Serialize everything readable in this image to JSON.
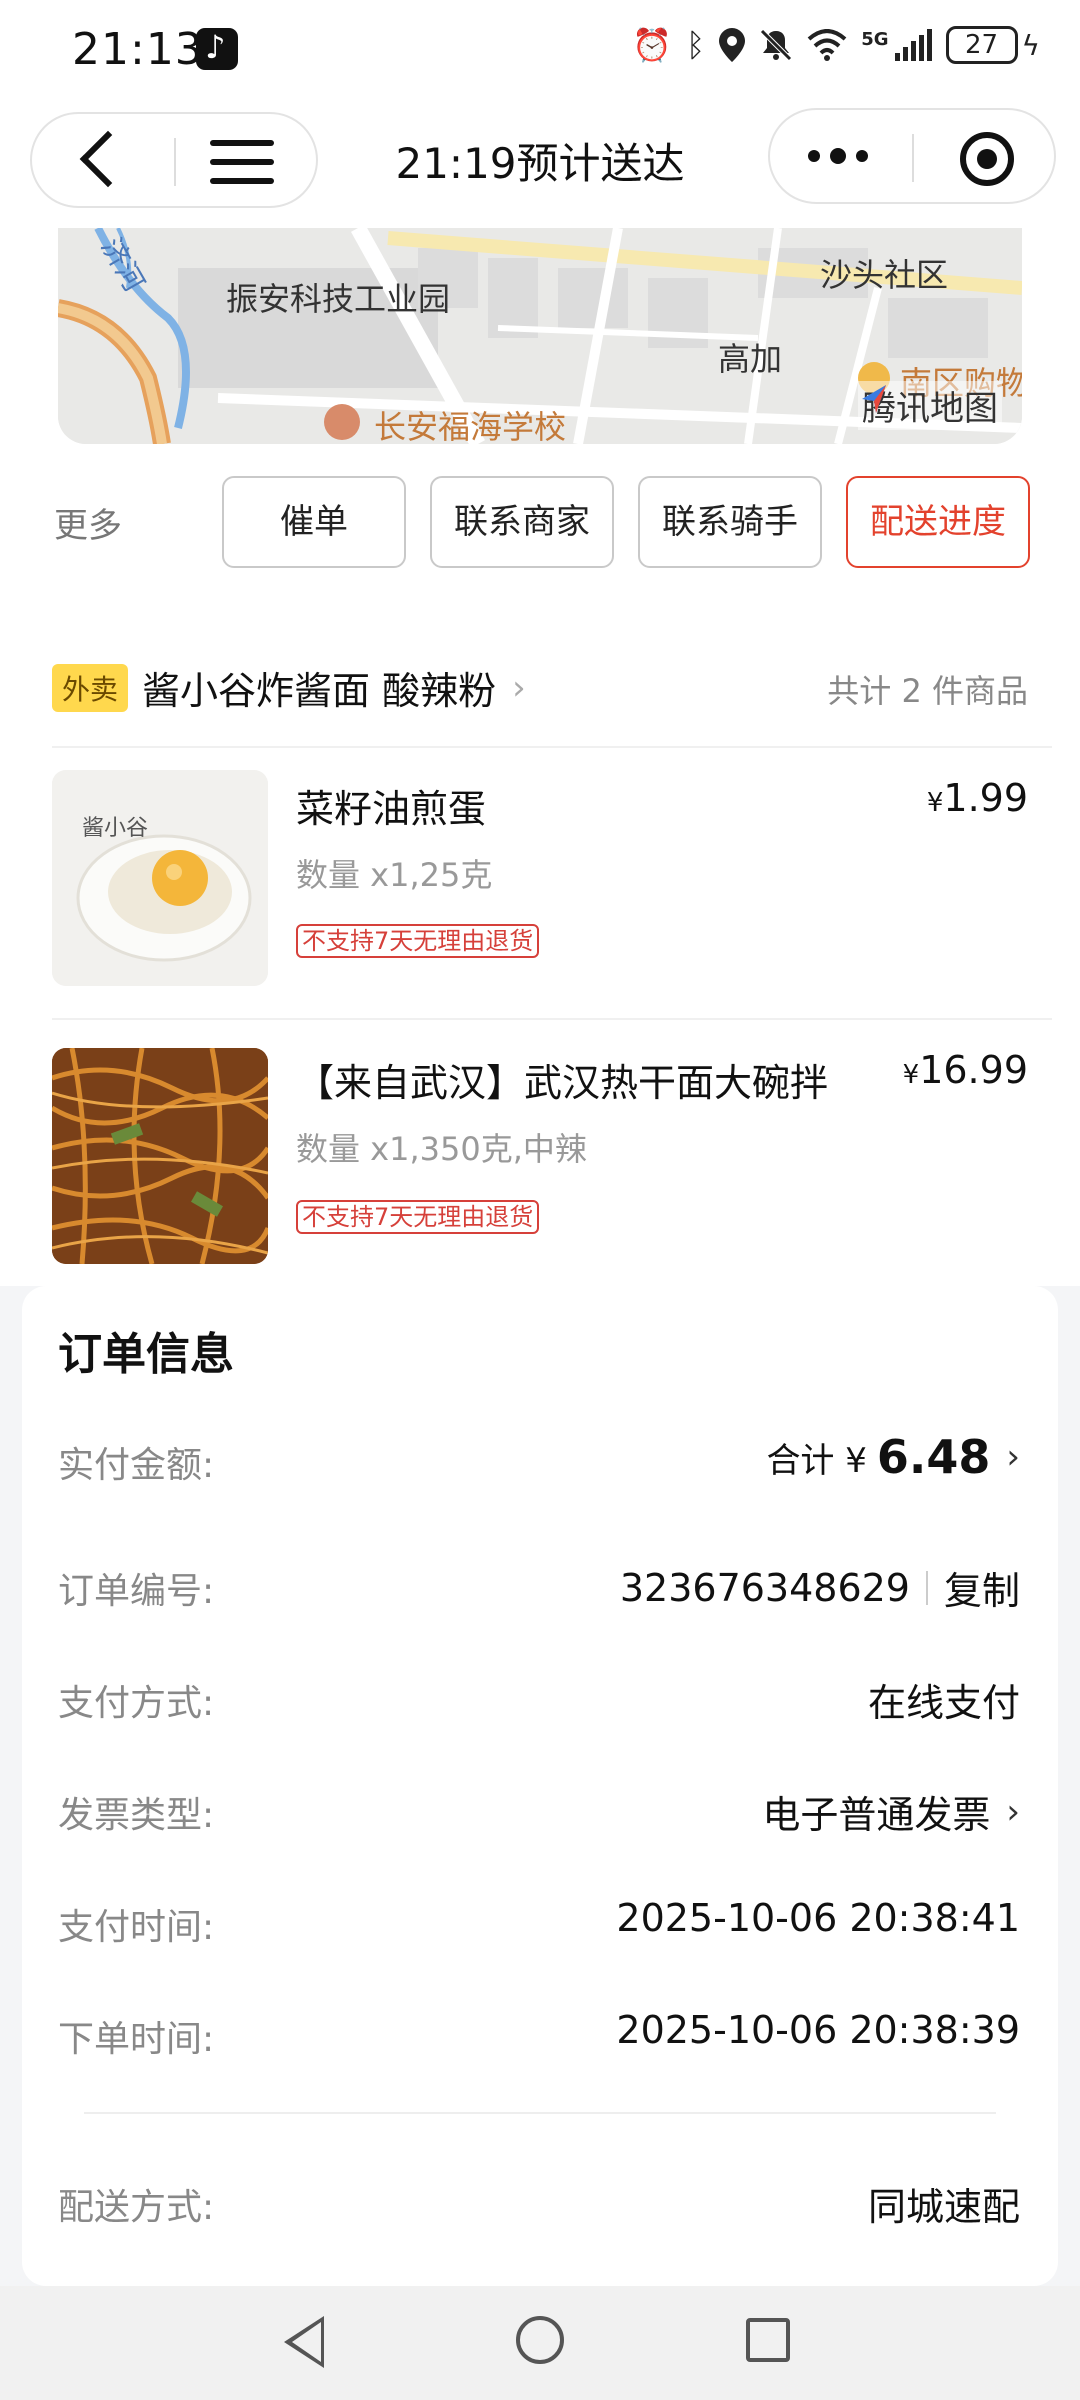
{
  "status_bar": {
    "time": "21:13",
    "network": "5G",
    "battery": "27",
    "icons": [
      "tiktok-icon",
      "alarm-icon",
      "bluetooth-icon",
      "location-icon",
      "mute-icon",
      "wifi-icon",
      "signal-icon",
      "battery-icon",
      "charging-icon"
    ]
  },
  "header": {
    "title": "21:19预计送达",
    "icons": [
      "back-icon",
      "menu-icon",
      "more-icon",
      "record-icon"
    ]
  },
  "map": {
    "labels": {
      "river": "济河",
      "park": "振安科技工业园",
      "community": "沙头社区",
      "gaojia": "高加",
      "mall": "南区购物",
      "school": "长安福海学校"
    },
    "logo": "腾讯地图"
  },
  "actions": {
    "more_label": "更多",
    "buttons": [
      "催单",
      "联系商家",
      "联系骑手",
      "配送进度"
    ]
  },
  "shop": {
    "tag": "外卖",
    "name": "酱小谷炸酱面 酸辣粉",
    "total": "共计 2 件商品"
  },
  "products": [
    {
      "name": "菜籽油煎蛋",
      "qty": "数量 x1,25克",
      "tag": "不支持7天无理由退货",
      "currency": "¥",
      "price": "1.99",
      "image_brand": "酱小谷"
    },
    {
      "name": "【来自武汉】武汉热干面大碗拌",
      "qty": "数量 x1,350克,中辣",
      "tag": "不支持7天无理由退货",
      "currency": "¥",
      "price": "16.99"
    }
  ],
  "order_info": {
    "title": "订单信息",
    "rows": [
      {
        "label": "实付金额:",
        "prefix": "合计 ¥",
        "value": "6.48"
      },
      {
        "label": "订单编号:",
        "value": "323676348629",
        "action": "复制"
      },
      {
        "label": "支付方式:",
        "value": "在线支付"
      },
      {
        "label": "发票类型:",
        "value": "电子普通发票"
      },
      {
        "label": "支付时间:",
        "value": "2025-10-06 20:38:41"
      },
      {
        "label": "下单时间:",
        "value": "2025-10-06 20:38:39"
      },
      {
        "label": "配送方式:",
        "value": "同城速配"
      }
    ]
  },
  "colors": {
    "accent": "#e3422d",
    "tag_yellow": "#ffd84d",
    "muted_text": "#888888"
  },
  "nav_bar": {
    "icons": [
      "nav-back-icon",
      "nav-home-icon",
      "nav-recent-icon"
    ]
  }
}
